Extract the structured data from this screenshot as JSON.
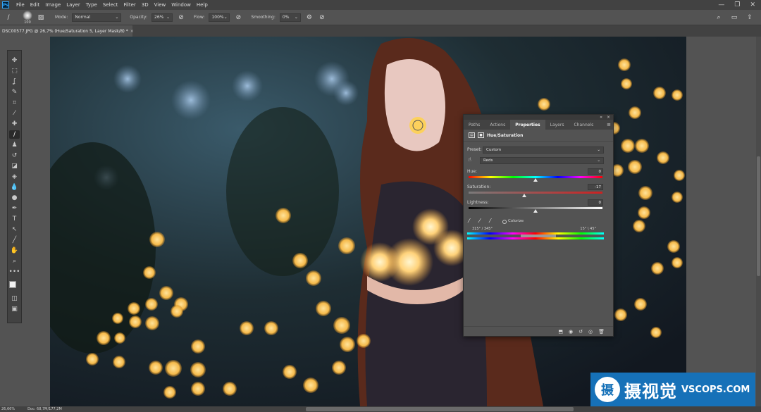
{
  "app": {
    "logo_text": "Ps"
  },
  "menu": [
    "File",
    "Edit",
    "Image",
    "Layer",
    "Type",
    "Select",
    "Filter",
    "3D",
    "View",
    "Window",
    "Help"
  ],
  "window_controls": [
    "—",
    "❐",
    "✕"
  ],
  "options_bar": {
    "brush_size": "100",
    "mode_label": "Mode:",
    "mode_value": "Normal",
    "opacity_label": "Opacity:",
    "opacity_value": "26%",
    "flow_label": "Flow:",
    "flow_value": "100%",
    "smoothing_label": "Smoothing:",
    "smoothing_value": "0%"
  },
  "document_tab": {
    "title": "DSC00577.JPG @ 26,7% (Hue/Saturation 5, Layer Mask/8) *",
    "close": "×"
  },
  "toolbar_tools": [
    {
      "name": "move-tool",
      "glyph": "✥"
    },
    {
      "name": "marquee-tool",
      "glyph": "⬚"
    },
    {
      "name": "lasso-tool",
      "glyph": "ʆ"
    },
    {
      "name": "quick-select-tool",
      "glyph": "✎"
    },
    {
      "name": "crop-tool",
      "glyph": "⌗"
    },
    {
      "name": "eyedropper-tool",
      "glyph": "⁄"
    },
    {
      "name": "healing-brush-tool",
      "glyph": "✚"
    },
    {
      "name": "brush-tool",
      "glyph": "∕"
    },
    {
      "name": "clone-stamp-tool",
      "glyph": "♟"
    },
    {
      "name": "history-brush-tool",
      "glyph": "↺"
    },
    {
      "name": "eraser-tool",
      "glyph": "◪"
    },
    {
      "name": "paint-bucket-tool",
      "glyph": "◈"
    },
    {
      "name": "blur-tool",
      "glyph": "💧"
    },
    {
      "name": "dodge-tool",
      "glyph": "●"
    },
    {
      "name": "pen-tool",
      "glyph": "✒"
    },
    {
      "name": "type-tool",
      "glyph": "T"
    },
    {
      "name": "path-select-tool",
      "glyph": "↖"
    },
    {
      "name": "line-tool",
      "glyph": "╱"
    },
    {
      "name": "hand-tool",
      "glyph": "✋"
    },
    {
      "name": "zoom-tool",
      "glyph": "⌕"
    },
    {
      "name": "more-tools",
      "glyph": "•••"
    }
  ],
  "status_bar": {
    "zoom": "26,66%",
    "doc_info": "Doc: 68,7M/177,2M"
  },
  "panel": {
    "tabs": [
      "Paths",
      "Actions",
      "Properties",
      "Layers",
      "Channels"
    ],
    "active_tab": "Properties",
    "title": "Hue/Saturation",
    "preset_label": "Preset:",
    "preset_value": "Custom",
    "channel_value": "Reds",
    "hue_label": "Hue:",
    "hue_value": "0",
    "saturation_label": "Saturation:",
    "saturation_value": "-17",
    "lightness_label": "Lightness:",
    "lightness_value": "0",
    "colorize_label": "Colorize",
    "range_left": "315° / 345°",
    "range_right": "15° \\ 45°",
    "collapse": "«",
    "close": "×",
    "menu_icon": "≡"
  },
  "watermark": {
    "logo": "摄",
    "chinese": "摄视觉",
    "english": "VSCOPS.COM"
  }
}
